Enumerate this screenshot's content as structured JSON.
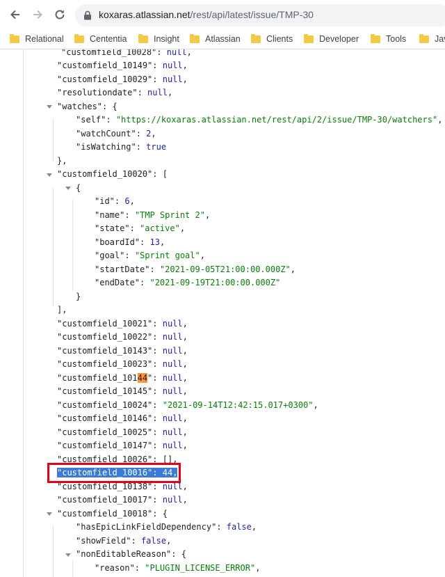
{
  "browser": {
    "url_domain": "koxaras.atlassian.net",
    "url_path": "/rest/api/latest/issue/TMP-30",
    "bookmarks": [
      {
        "label": "Relational"
      },
      {
        "label": "Cententia"
      },
      {
        "label": "Insight"
      },
      {
        "label": "Atlassian"
      },
      {
        "label": "Clients"
      },
      {
        "label": "Developer"
      },
      {
        "label": "Tools"
      },
      {
        "label": "Jav"
      }
    ]
  },
  "json": {
    "l0_key": "\"customfield_10028\"",
    "l0_val": "null",
    "l1_key": "\"customfield_10149\"",
    "l1_val": "null",
    "l2_key": "\"customfield_10029\"",
    "l2_val": "null",
    "l3_key": "\"resolutiondate\"",
    "l3_val": "null",
    "l4_key": "\"watches\"",
    "l5_key": "\"self\"",
    "l5_val": "\"https://koxaras.atlassian.net/rest/api/2/issue/TMP-30/watchers\"",
    "l6_key": "\"watchCount\"",
    "l6_val": "2",
    "l7_key": "\"isWatching\"",
    "l7_val": "true",
    "l9_key": "\"customfield_10020\"",
    "l11_key": "\"id\"",
    "l11_val": "6",
    "l12_key": "\"name\"",
    "l12_val": "\"TMP Sprint 2\"",
    "l13_key": "\"state\"",
    "l13_val": "\"active\"",
    "l14_key": "\"boardId\"",
    "l14_val": "13",
    "l15_key": "\"goal\"",
    "l15_val": "\"Sprint goal\"",
    "l16_key": "\"startDate\"",
    "l16_val": "\"2021-09-05T21:00:00.000Z\"",
    "l17_key": "\"endDate\"",
    "l17_val": "\"2021-09-19T21:00:00.000Z\"",
    "l20_key": "\"customfield_10021\"",
    "l20_val": "null",
    "l21_key": "\"customfield_10022\"",
    "l21_val": "null",
    "l22_key": "\"customfield_10143\"",
    "l22_val": "null",
    "l23_key": "\"customfield_10023\"",
    "l23_val": "null",
    "l24_key_a": "\"customfield_101",
    "l24_key_hl": "44",
    "l24_key_b": "\"",
    "l24_val": "null",
    "l25_key": "\"customfield_10145\"",
    "l25_val": "null",
    "l26_key": "\"customfield_10024\"",
    "l26_val": "\"2021-09-14T12:42:15.017+0300\"",
    "l27_key": "\"customfield_10146\"",
    "l27_val": "null",
    "l28_key": "\"customfield_10025\"",
    "l28_val": "null",
    "l29_key": "\"customfield_10147\"",
    "l29_val": "null",
    "l30_key": "\"customfield_10026\"",
    "l30_val": "[]",
    "l31_key": "\"customfield_10016\"",
    "l31_val": "44",
    "l32_key": "\"customfield_10138\"",
    "l32_val": "null",
    "l33_key": "\"customfield_10017\"",
    "l33_val": "null",
    "l34_key": "\"customfield_10018\"",
    "l35_key": "\"hasEpicLinkFieldDependency\"",
    "l35_val": "false",
    "l36_key": "\"showField\"",
    "l36_val": "false",
    "l37_key": "\"nonEditableReason\"",
    "l38_key": "\"reason\"",
    "l38_val": "\"PLUGIN_LICENSE_ERROR\""
  }
}
